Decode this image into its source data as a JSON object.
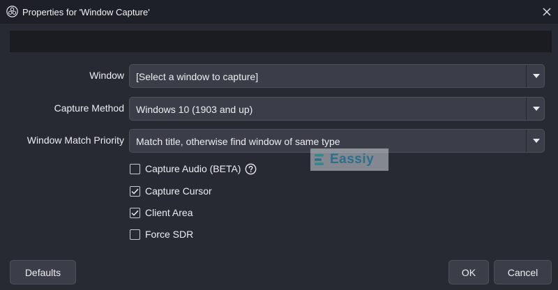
{
  "window": {
    "title": "Properties for 'Window Capture'"
  },
  "fields": {
    "window": {
      "label": "Window",
      "value": "[Select a window to capture]"
    },
    "capture_method": {
      "label": "Capture Method",
      "value": "Windows 10 (1903 and up)"
    },
    "match_priority": {
      "label": "Window Match Priority",
      "value": "Match title, otherwise find window of same type"
    }
  },
  "checkboxes": [
    {
      "label": "Capture Audio (BETA)",
      "checked": false,
      "has_help": true
    },
    {
      "label": "Capture Cursor",
      "checked": true,
      "has_help": false
    },
    {
      "label": "Client Area",
      "checked": true,
      "has_help": false
    },
    {
      "label": "Force SDR",
      "checked": false,
      "has_help": false
    }
  ],
  "watermark": {
    "text": "Eassiy"
  },
  "buttons": {
    "defaults": "Defaults",
    "ok": "OK",
    "cancel": "Cancel"
  },
  "colors": {
    "background": "#272a33",
    "titlebar": "#1e2027",
    "control": "#3b3e48",
    "text": "#eceef2"
  }
}
